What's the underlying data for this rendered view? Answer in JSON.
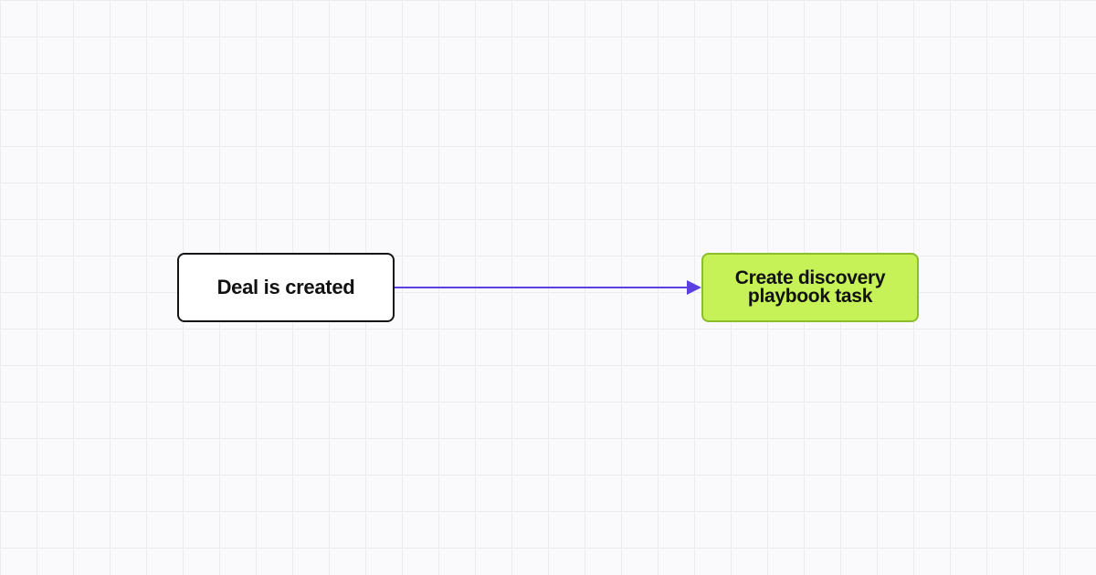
{
  "diagram": {
    "nodes": [
      {
        "id": "trigger",
        "label": "Deal is created"
      },
      {
        "id": "action",
        "label": "Create discovery playbook task"
      }
    ],
    "edges": [
      {
        "from": "trigger",
        "to": "action"
      }
    ],
    "colors": {
      "background": "#fafafc",
      "grid": "#ececf0",
      "trigger_fill": "#ffffff",
      "trigger_border": "#151515",
      "action_fill": "#c6f257",
      "action_border": "#8cbd2a",
      "connector": "#5b3fe0"
    }
  }
}
